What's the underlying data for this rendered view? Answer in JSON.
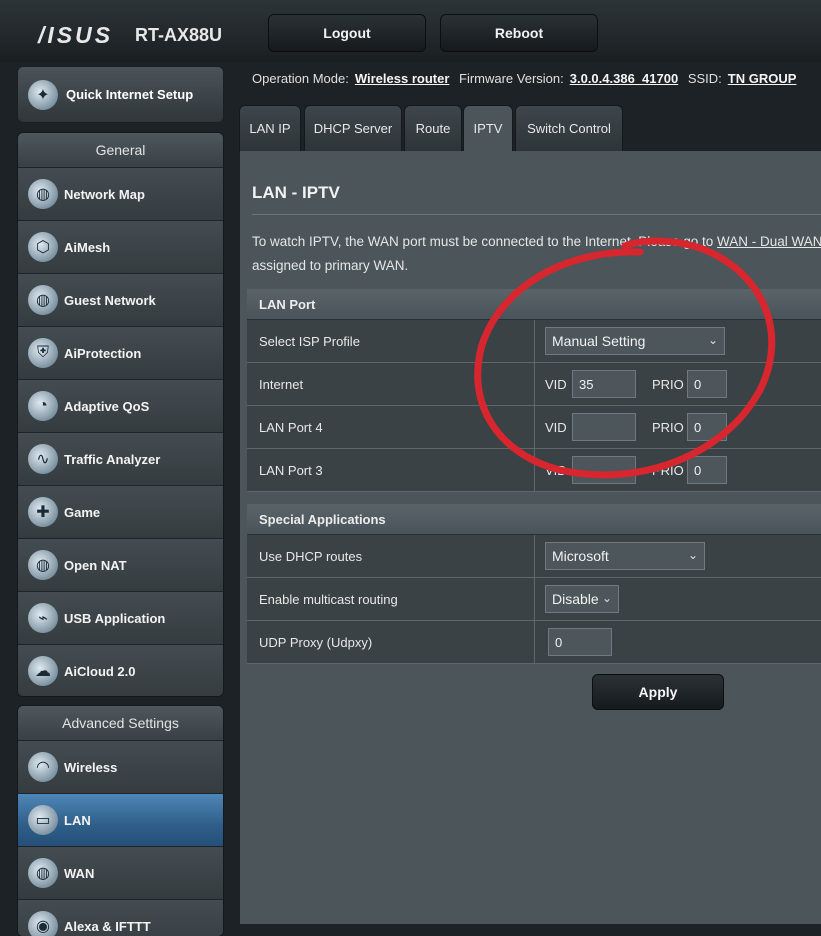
{
  "header": {
    "brand": "/ISUS",
    "model": "RT-AX88U",
    "logout_label": "Logout",
    "reboot_label": "Reboot"
  },
  "sidebar": {
    "quick_setup": "Quick Internet Setup",
    "general_heading": "General",
    "general_items": [
      {
        "label": "Network Map",
        "icon": "globe-network-icon"
      },
      {
        "label": "AiMesh",
        "icon": "mesh-icon"
      },
      {
        "label": "Guest Network",
        "icon": "guest-globe-icon"
      },
      {
        "label": "AiProtection",
        "icon": "shield-lock-icon"
      },
      {
        "label": "Adaptive QoS",
        "icon": "speedometer-icon"
      },
      {
        "label": "Traffic Analyzer",
        "icon": "pulse-icon"
      },
      {
        "label": "Game",
        "icon": "gamepad-icon"
      },
      {
        "label": "Open NAT",
        "icon": "open-nat-icon"
      },
      {
        "label": "USB Application",
        "icon": "usb-icon"
      },
      {
        "label": "AiCloud 2.0",
        "icon": "cloud-icon"
      }
    ],
    "advanced_heading": "Advanced Settings",
    "advanced_items": [
      {
        "label": "Wireless",
        "icon": "wireless-icon"
      },
      {
        "label": "LAN",
        "icon": "lan-icon",
        "active": true
      },
      {
        "label": "WAN",
        "icon": "wan-globe-icon"
      },
      {
        "label": "Alexa & IFTTT",
        "icon": "alexa-icon"
      }
    ]
  },
  "status": {
    "op_mode_label": "Operation Mode:",
    "op_mode_value": "Wireless router",
    "fw_label": "Firmware Version:",
    "fw_value": "3.0.0.4.386_41700",
    "ssid_label": "SSID:",
    "ssid_value": "TN GROUP"
  },
  "tabs": [
    "LAN IP",
    "DHCP Server",
    "Route",
    "IPTV",
    "Switch Control"
  ],
  "active_tab": "IPTV",
  "page": {
    "title": "LAN - IPTV",
    "desc_line1_a": "To watch IPTV, the WAN port must be connected to the Internet. Please go to ",
    "desc_link": "WAN - Dual WAN",
    "desc_line2": "assigned to primary WAN."
  },
  "lan_port": {
    "heading": "LAN Port",
    "isp_profile_label": "Select ISP Profile",
    "isp_profile_value": "Manual Setting",
    "rows": [
      {
        "label": "Internet",
        "vid": "35",
        "prio": "0"
      },
      {
        "label": "LAN Port 4",
        "vid": "",
        "prio": "0"
      },
      {
        "label": "LAN Port 3",
        "vid": "",
        "prio": "0"
      }
    ],
    "vid_label": "VID",
    "prio_label": "PRIO"
  },
  "special": {
    "heading": "Special Applications",
    "dhcp_routes_label": "Use DHCP routes",
    "dhcp_routes_value": "Microsoft",
    "multicast_label": "Enable multicast routing",
    "multicast_value": "Disable",
    "udpxy_label": "UDP Proxy (Udpxy)",
    "udpxy_value": "0"
  },
  "apply_label": "Apply",
  "annotation_color": "#d8262f"
}
